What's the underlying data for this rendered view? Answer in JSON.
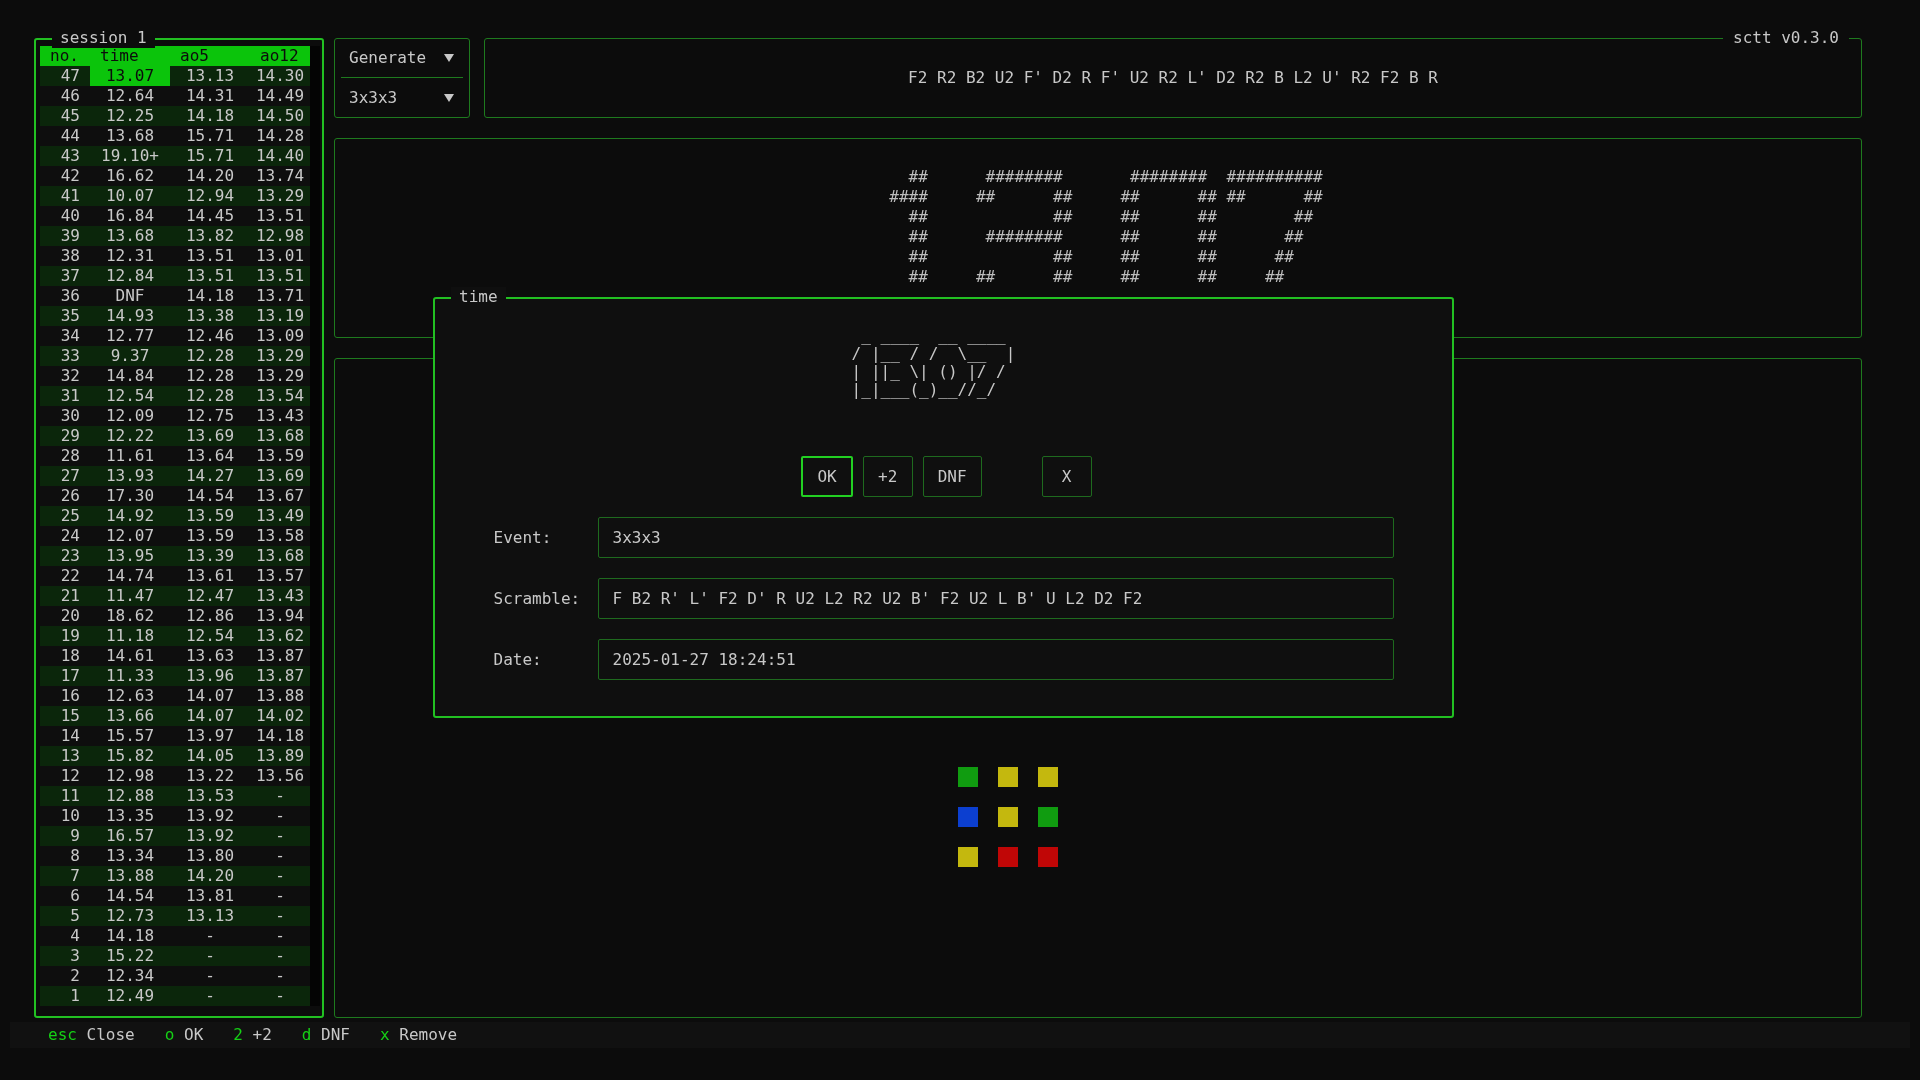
{
  "session": {
    "title": "session 1",
    "columns": [
      "no.",
      "time",
      "ao5",
      "ao12"
    ],
    "rows": [
      {
        "no": "47",
        "time": "13.07",
        "ao5": "13.13",
        "ao12": "14.30",
        "selected": true
      },
      {
        "no": "46",
        "time": "12.64",
        "ao5": "14.31",
        "ao12": "14.49",
        "selected": false
      },
      {
        "no": "45",
        "time": "12.25",
        "ao5": "14.18",
        "ao12": "14.50",
        "selected": false
      },
      {
        "no": "44",
        "time": "13.68",
        "ao5": "15.71",
        "ao12": "14.28",
        "selected": false
      },
      {
        "no": "43",
        "time": "19.10+",
        "ao5": "15.71",
        "ao12": "14.40",
        "selected": false
      },
      {
        "no": "42",
        "time": "16.62",
        "ao5": "14.20",
        "ao12": "13.74",
        "selected": false
      },
      {
        "no": "41",
        "time": "10.07",
        "ao5": "12.94",
        "ao12": "13.29",
        "selected": false
      },
      {
        "no": "40",
        "time": "16.84",
        "ao5": "14.45",
        "ao12": "13.51",
        "selected": false
      },
      {
        "no": "39",
        "time": "13.68",
        "ao5": "13.82",
        "ao12": "12.98",
        "selected": false
      },
      {
        "no": "38",
        "time": "12.31",
        "ao5": "13.51",
        "ao12": "13.01",
        "selected": false
      },
      {
        "no": "37",
        "time": "12.84",
        "ao5": "13.51",
        "ao12": "13.51",
        "selected": false
      },
      {
        "no": "36",
        "time": "DNF",
        "ao5": "14.18",
        "ao12": "13.71",
        "selected": false
      },
      {
        "no": "35",
        "time": "14.93",
        "ao5": "13.38",
        "ao12": "13.19",
        "selected": false
      },
      {
        "no": "34",
        "time": "12.77",
        "ao5": "12.46",
        "ao12": "13.09",
        "selected": false
      },
      {
        "no": "33",
        "time": "9.37",
        "ao5": "12.28",
        "ao12": "13.29",
        "selected": false
      },
      {
        "no": "32",
        "time": "14.84",
        "ao5": "12.28",
        "ao12": "13.29",
        "selected": false
      },
      {
        "no": "31",
        "time": "12.54",
        "ao5": "12.28",
        "ao12": "13.54",
        "selected": false
      },
      {
        "no": "30",
        "time": "12.09",
        "ao5": "12.75",
        "ao12": "13.43",
        "selected": false
      },
      {
        "no": "29",
        "time": "12.22",
        "ao5": "13.69",
        "ao12": "13.68",
        "selected": false
      },
      {
        "no": "28",
        "time": "11.61",
        "ao5": "13.64",
        "ao12": "13.59",
        "selected": false
      },
      {
        "no": "27",
        "time": "13.93",
        "ao5": "14.27",
        "ao12": "13.69",
        "selected": false
      },
      {
        "no": "26",
        "time": "17.30",
        "ao5": "14.54",
        "ao12": "13.67",
        "selected": false
      },
      {
        "no": "25",
        "time": "14.92",
        "ao5": "13.59",
        "ao12": "13.49",
        "selected": false
      },
      {
        "no": "24",
        "time": "12.07",
        "ao5": "13.59",
        "ao12": "13.58",
        "selected": false
      },
      {
        "no": "23",
        "time": "13.95",
        "ao5": "13.39",
        "ao12": "13.68",
        "selected": false
      },
      {
        "no": "22",
        "time": "14.74",
        "ao5": "13.61",
        "ao12": "13.57",
        "selected": false
      },
      {
        "no": "21",
        "time": "11.47",
        "ao5": "12.47",
        "ao12": "13.43",
        "selected": false
      },
      {
        "no": "20",
        "time": "18.62",
        "ao5": "12.86",
        "ao12": "13.94",
        "selected": false
      },
      {
        "no": "19",
        "time": "11.18",
        "ao5": "12.54",
        "ao12": "13.62",
        "selected": false
      },
      {
        "no": "18",
        "time": "14.61",
        "ao5": "13.63",
        "ao12": "13.87",
        "selected": false
      },
      {
        "no": "17",
        "time": "11.33",
        "ao5": "13.96",
        "ao12": "13.87",
        "selected": false
      },
      {
        "no": "16",
        "time": "12.63",
        "ao5": "14.07",
        "ao12": "13.88",
        "selected": false
      },
      {
        "no": "15",
        "time": "13.66",
        "ao5": "14.07",
        "ao12": "14.02",
        "selected": false
      },
      {
        "no": "14",
        "time": "15.57",
        "ao5": "13.97",
        "ao12": "14.18",
        "selected": false
      },
      {
        "no": "13",
        "time": "15.82",
        "ao5": "14.05",
        "ao12": "13.89",
        "selected": false
      },
      {
        "no": "12",
        "time": "12.98",
        "ao5": "13.22",
        "ao12": "13.56",
        "selected": false
      },
      {
        "no": "11",
        "time": "12.88",
        "ao5": "13.53",
        "ao12": "-",
        "selected": false
      },
      {
        "no": "10",
        "time": "13.35",
        "ao5": "13.92",
        "ao12": "-",
        "selected": false
      },
      {
        "no": "9",
        "time": "16.57",
        "ao5": "13.92",
        "ao12": "-",
        "selected": false
      },
      {
        "no": "8",
        "time": "13.34",
        "ao5": "13.80",
        "ao12": "-",
        "selected": false
      },
      {
        "no": "7",
        "time": "13.88",
        "ao5": "14.20",
        "ao12": "-",
        "selected": false
      },
      {
        "no": "6",
        "time": "14.54",
        "ao5": "13.81",
        "ao12": "-",
        "selected": false
      },
      {
        "no": "5",
        "time": "12.73",
        "ao5": "13.13",
        "ao12": "-",
        "selected": false
      },
      {
        "no": "4",
        "time": "14.18",
        "ao5": "-",
        "ao12": "-",
        "selected": false
      },
      {
        "no": "3",
        "time": "15.22",
        "ao5": "-",
        "ao12": "-",
        "selected": false
      },
      {
        "no": "2",
        "time": "12.34",
        "ao5": "-",
        "ao12": "-",
        "selected": false
      },
      {
        "no": "1",
        "time": "12.49",
        "ao5": "-",
        "ao12": "-",
        "selected": false
      }
    ]
  },
  "dropdowns": [
    "Generate",
    "3x3x3"
  ],
  "app_title": "sctt v0.3.0",
  "scramble": "F2 R2 B2 U2 F' D2 R F' U2 R2 L' D2 R2 B L2 U' R2 F2 B R",
  "big_time_art": [
    "  ##      ########       ########  ##########",
    "####     ##      ##     ##      ## ##      ##",
    "  ##             ##     ##      ##        ##",
    "  ##      ########      ##      ##       ##",
    "  ##             ##     ##      ##      ##",
    "  ##     ##      ##     ##      ##     ##"
  ],
  "dialog": {
    "title": "time",
    "time_art": [
      " _ ____  __ ____ ",
      "/ |__ / /  \\__  |",
      "| ||_ \\| () |/ / ",
      "|_|___(_)__//_/  "
    ],
    "buttons": [
      {
        "label": "OK",
        "focused": true,
        "kind": "action"
      },
      {
        "label": "+2",
        "focused": false,
        "kind": "action"
      },
      {
        "label": "DNF",
        "focused": false,
        "kind": "action"
      },
      {
        "label": "X",
        "focused": false,
        "kind": "remove"
      }
    ],
    "fields": [
      {
        "label": "Event:",
        "value": "3x3x3"
      },
      {
        "label": "Scramble:",
        "value": "F B2 R' L' F2 D' R U2 L2 R2 U2 B' F2 U2 L B' U L2 D2 F2"
      },
      {
        "label": "Date:",
        "value": "2025-01-27 18:24:51"
      }
    ]
  },
  "cube_face": [
    {
      "color": "#109c10"
    },
    {
      "color": "#c4b80e"
    },
    {
      "color": "#c4b80e"
    },
    {
      "color": "#0c3fd0"
    },
    {
      "color": "#c4b80e"
    },
    {
      "color": "#109c10"
    },
    {
      "color": "#c4b80e"
    },
    {
      "color": "#c00606"
    },
    {
      "color": "#c00606"
    }
  ],
  "key_hints": [
    {
      "key": "esc",
      "action": "Close"
    },
    {
      "key": "o",
      "action": "OK"
    },
    {
      "key": "2",
      "action": "+2"
    },
    {
      "key": "d",
      "action": "DNF"
    },
    {
      "key": "x",
      "action": "Remove"
    }
  ]
}
